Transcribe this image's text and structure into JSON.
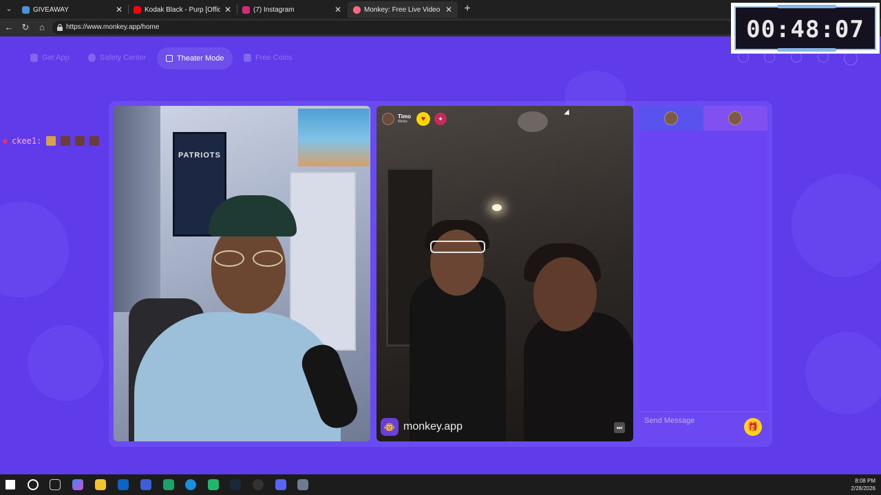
{
  "browser": {
    "tabs": [
      {
        "title": "GIVEAWAY",
        "favicon_color": "#4a90e2"
      },
      {
        "title": "Kodak Black - Purp [Official Audio]",
        "favicon_color": "#ff0000"
      },
      {
        "title": "(7) Instagram",
        "favicon_color": "#d62976"
      },
      {
        "title": "Monkey: Free Live Video Chat",
        "favicon_color": "#ff6b81"
      }
    ],
    "url": "https://www.monkey.app/home"
  },
  "nav": {
    "get_app": "Get App",
    "safety_center": "Safety Center",
    "theater_mode": "Theater Mode",
    "free_coins": "Free Coins"
  },
  "overlay_chat": {
    "username": "ckee1:"
  },
  "left_video": {
    "poster_text": "PATRIOTS"
  },
  "peer": {
    "name": "Timo",
    "location": "Illinois"
  },
  "brand": {
    "text": "monkey.app"
  },
  "chat_panel": {
    "placeholder": "Send Message"
  },
  "timer": {
    "value": "00:48:07"
  },
  "taskbar": {
    "time": "8:08 PM",
    "date": "2/28/2026"
  },
  "colors": {
    "page_bg": "#5f3bea",
    "chat_panel_bg": "#6a44f2",
    "accent_yellow": "#ffd21f"
  }
}
